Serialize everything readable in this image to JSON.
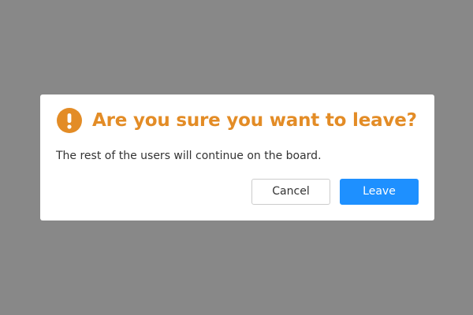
{
  "dialog": {
    "title": "Are you sure you want to leave?",
    "message": "The rest of the users will continue on the board.",
    "icon": "exclamation-circle-icon",
    "buttons": {
      "cancel_label": "Cancel",
      "leave_label": "Leave"
    }
  },
  "colors": {
    "backdrop": "#888888",
    "warning": "#e38c26",
    "primary": "#1e90ff",
    "dialog_background": "#ffffff"
  }
}
